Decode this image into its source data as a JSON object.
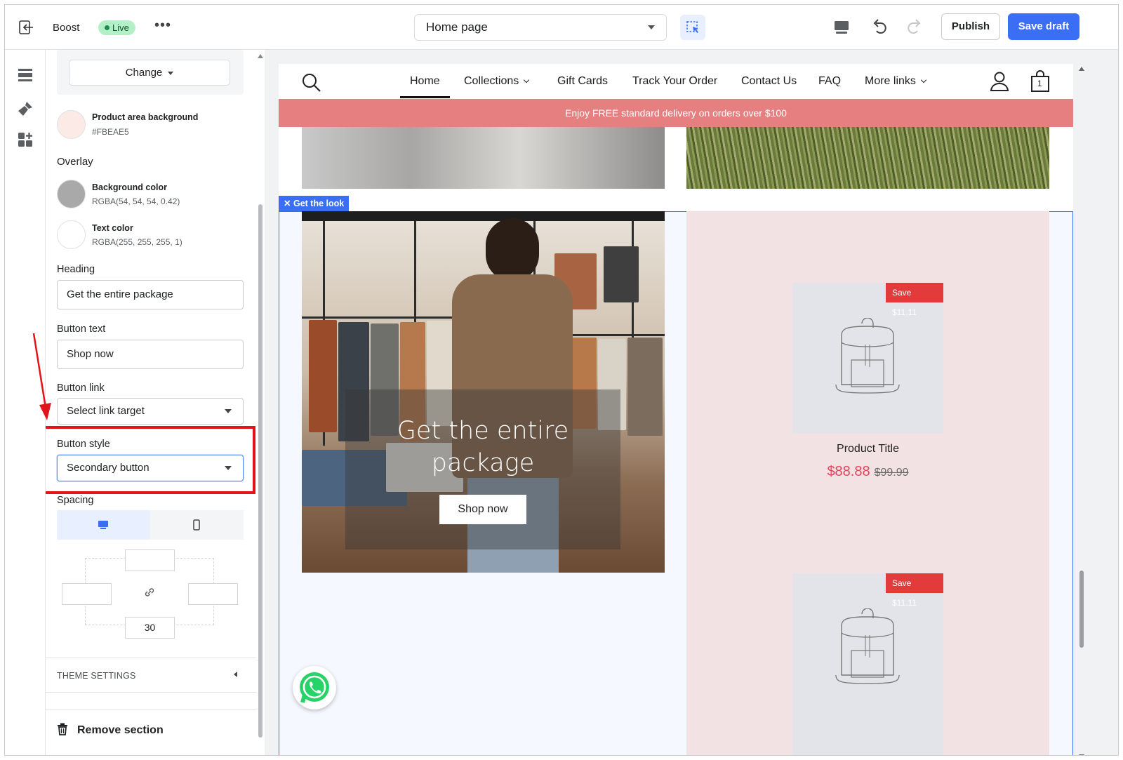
{
  "topbar": {
    "app_name": "Boost",
    "status_badge": "Live",
    "page_selector": "Home page",
    "publish_label": "Publish",
    "save_draft_label": "Save draft"
  },
  "panel": {
    "change_label": "Change",
    "product_area_bg": {
      "title": "Product area background",
      "value": "#FBEAE5",
      "color": "#FBEAE5"
    },
    "overlay_heading": "Overlay",
    "overlay_bg": {
      "title": "Background color",
      "value": "RGBA(54, 54, 54, 0.42)",
      "color": "#a9a9a9"
    },
    "overlay_text": {
      "title": "Text color",
      "value": "RGBA(255, 255, 255, 1)",
      "color": "#ffffff"
    },
    "heading": {
      "label": "Heading",
      "value": "Get the entire package"
    },
    "button_text": {
      "label": "Button text",
      "value": "Shop now"
    },
    "button_link": {
      "label": "Button link",
      "value": "Select link target"
    },
    "button_style": {
      "label": "Button style",
      "value": "Secondary button"
    },
    "spacing": {
      "label": "Spacing",
      "bottom_value": "30"
    },
    "theme_settings": "THEME SETTINGS",
    "remove_section": "Remove section"
  },
  "store": {
    "nav": [
      "Home",
      "Collections",
      "Gift Cards",
      "Track Your Order",
      "Contact Us",
      "FAQ",
      "More links"
    ],
    "cart_count": "1",
    "banner": "Enjoy FREE standard delivery on orders over $100",
    "section_tag": "Get the look",
    "hero_heading": "Get the entire package",
    "hero_button": "Shop now",
    "products": [
      {
        "badge": "Save $11.11",
        "title": "Product Title",
        "price": "$88.88",
        "compare": "$99.99"
      },
      {
        "badge": "Save $11.11"
      }
    ]
  },
  "colors": {
    "accent": "#3a6ef5",
    "highlight": "#e3131b",
    "banner": "#e68080",
    "sale": "#e0445a"
  }
}
